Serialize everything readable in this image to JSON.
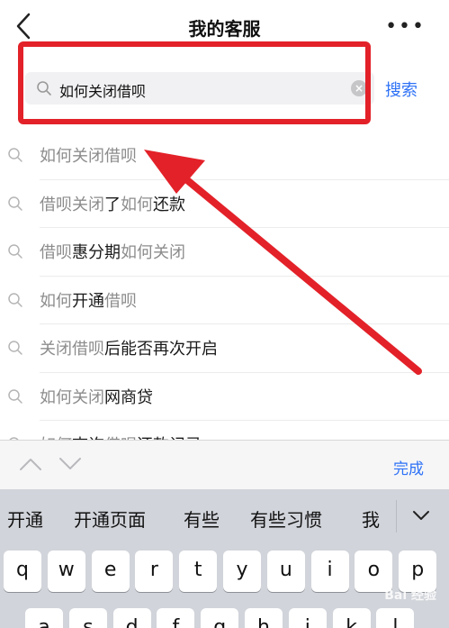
{
  "header": {
    "title": "我的客服"
  },
  "search": {
    "query": "如何关闭借呗",
    "button_label": "搜索"
  },
  "suggestions": [
    {
      "parts": [
        {
          "text": "如何关闭借呗",
          "hl": true
        }
      ]
    },
    {
      "parts": [
        {
          "text": "借呗关闭",
          "hl": true
        },
        {
          "text": "了",
          "hl": false
        },
        {
          "text": "如何",
          "hl": true
        },
        {
          "text": "还款",
          "hl": false
        }
      ]
    },
    {
      "parts": [
        {
          "text": "借呗",
          "hl": true
        },
        {
          "text": "惠分期",
          "hl": false
        },
        {
          "text": "如何关闭",
          "hl": true
        }
      ]
    },
    {
      "parts": [
        {
          "text": "如何",
          "hl": true
        },
        {
          "text": "开通",
          "hl": false
        },
        {
          "text": "借呗",
          "hl": true
        }
      ]
    },
    {
      "parts": [
        {
          "text": "关闭借呗",
          "hl": true
        },
        {
          "text": "后能否再次开启",
          "hl": false
        }
      ]
    },
    {
      "parts": [
        {
          "text": "如何关闭",
          "hl": true
        },
        {
          "text": "网商贷",
          "hl": false
        }
      ]
    },
    {
      "parts": [
        {
          "text": "如何",
          "hl": true
        },
        {
          "text": "查询",
          "hl": false
        },
        {
          "text": "借呗",
          "hl": true
        },
        {
          "text": "还款记录",
          "hl": false
        }
      ]
    }
  ],
  "keyboard": {
    "done_label": "完成",
    "candidates": [
      "开通",
      "开通页面",
      "有些",
      "有些习惯",
      "我"
    ],
    "row1": [
      "q",
      "w",
      "e",
      "r",
      "t",
      "y",
      "u",
      "i",
      "o",
      "p"
    ],
    "row2": [
      "a",
      "s",
      "d",
      "f",
      "g",
      "h",
      "j",
      "k",
      "l"
    ]
  },
  "watermark": "Bai 经验",
  "colors": {
    "accent": "#2e72f6",
    "annotation": "#e32129",
    "highlight_text": "#8c8c8c"
  }
}
